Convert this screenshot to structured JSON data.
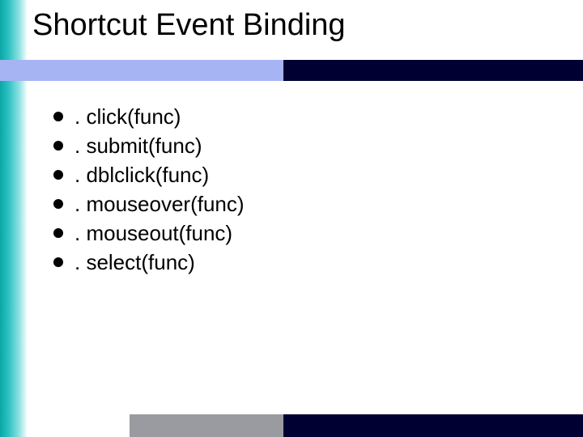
{
  "title": "Shortcut Event Binding",
  "bullets": [
    ". click(func)",
    ". submit(func)",
    ". dblclick(func)",
    ". mouseover(func)",
    ". mouseout(func)",
    ". select(func)"
  ]
}
